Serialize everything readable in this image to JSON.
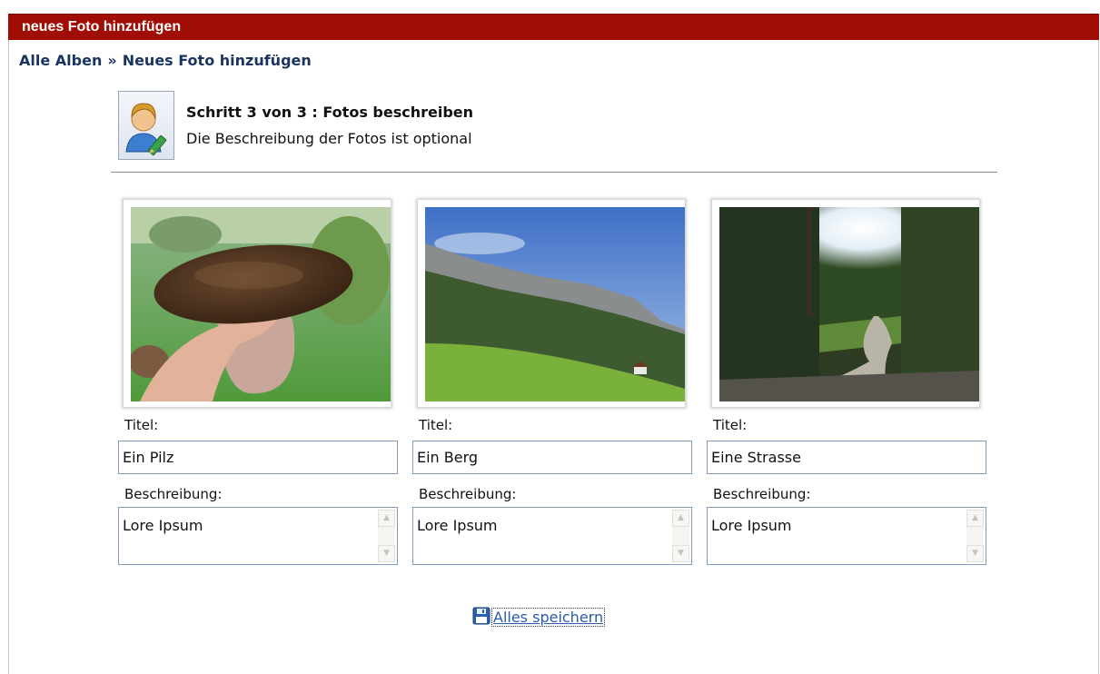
{
  "panel": {
    "title": "neues Foto hinzufügen"
  },
  "breadcrumb": {
    "root": "Alle Alben",
    "separator": "»",
    "current": "Neues Foto hinzufügen"
  },
  "step": {
    "title": "Schritt 3 von 3 : Fotos beschreiben",
    "subtitle": "Die Beschreibung der Fotos ist optional"
  },
  "photos": [
    {
      "title_label": "Titel:",
      "title_value": "Ein Pilz",
      "desc_label": "Beschreibung:",
      "desc_value": "Lore Ipsum"
    },
    {
      "title_label": "Titel:",
      "title_value": "Ein Berg",
      "desc_label": "Beschreibung:",
      "desc_value": "Lore Ipsum"
    },
    {
      "title_label": "Titel:",
      "title_value": "Eine Strasse",
      "desc_label": "Beschreibung:",
      "desc_value": "Lore Ipsum"
    }
  ],
  "save_button": {
    "label": "Alles speichern",
    "icon": "floppy-disk-icon"
  },
  "colors": {
    "header_bg": "#a00d04",
    "link": "#19355f",
    "save_link": "#2a5caa"
  }
}
